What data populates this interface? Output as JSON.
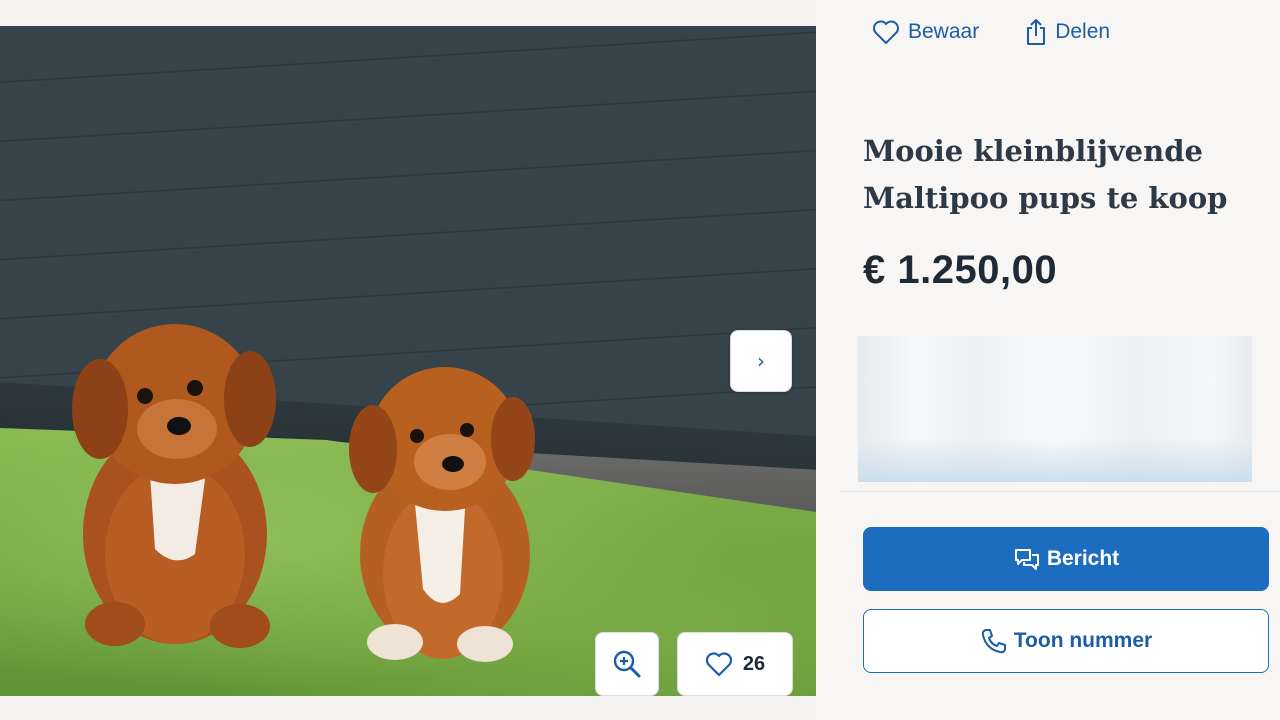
{
  "photo": {
    "next_icon": "chevron-right-icon",
    "zoom_icon": "zoom-in-icon",
    "likes_icon": "heart-icon",
    "likes_count": "26"
  },
  "actions": {
    "save_label": "Bewaar",
    "save_icon": "heart-outline-icon",
    "share_label": "Delen",
    "share_icon": "share-icon"
  },
  "listing": {
    "title": "Mooie kleinblijvende Maltipoo pups te koop",
    "price": "€ 1.250,00"
  },
  "buttons": {
    "message_label": "Bericht",
    "message_icon": "chat-bubbles-icon",
    "phone_label": "Toon nummer",
    "phone_icon": "phone-icon"
  },
  "colors": {
    "accent": "#1c6cbf",
    "link": "#1c5ea6",
    "text_dark": "#2d3a46"
  }
}
